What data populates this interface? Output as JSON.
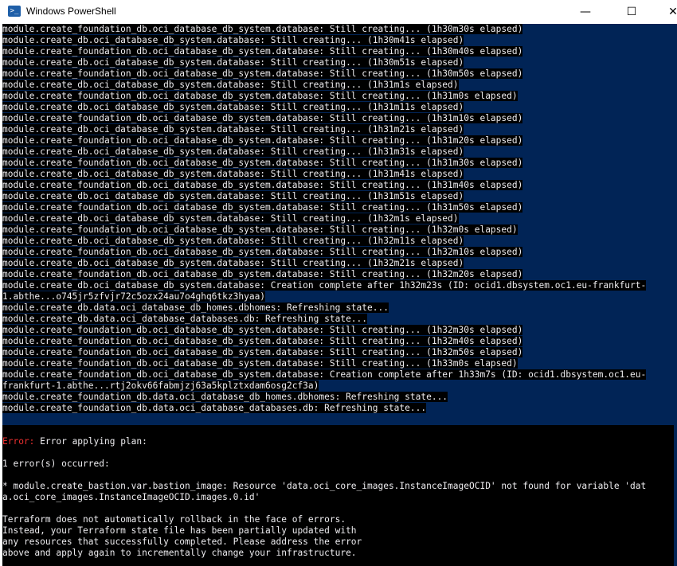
{
  "window": {
    "title": "Windows PowerShell",
    "icon": "powershell-icon",
    "minimize_glyph": "—",
    "maximize_glyph": "☐",
    "close_glyph": "✕"
  },
  "colors": {
    "console_bg": "#012456",
    "output_bg": "#000000",
    "text": "#eeedf0",
    "error": "#ee3030"
  },
  "log_lines": [
    "module.create_foundation_db.oci_database_db_system.database: Still creating... (1h30m30s elapsed)",
    "module.create_db.oci_database_db_system.database: Still creating... (1h30m41s elapsed)",
    "module.create_foundation_db.oci_database_db_system.database: Still creating... (1h30m40s elapsed)",
    "module.create_db.oci_database_db_system.database: Still creating... (1h30m51s elapsed)",
    "module.create_foundation_db.oci_database_db_system.database: Still creating... (1h30m50s elapsed)",
    "module.create_db.oci_database_db_system.database: Still creating... (1h31m1s elapsed)",
    "module.create_foundation_db.oci_database_db_system.database: Still creating... (1h31m0s elapsed)",
    "module.create_db.oci_database_db_system.database: Still creating... (1h31m11s elapsed)",
    "module.create_foundation_db.oci_database_db_system.database: Still creating... (1h31m10s elapsed)",
    "module.create_db.oci_database_db_system.database: Still creating... (1h31m21s elapsed)",
    "module.create_foundation_db.oci_database_db_system.database: Still creating... (1h31m20s elapsed)",
    "module.create_db.oci_database_db_system.database: Still creating... (1h31m31s elapsed)",
    "module.create_foundation_db.oci_database_db_system.database: Still creating... (1h31m30s elapsed)",
    "module.create_db.oci_database_db_system.database: Still creating... (1h31m41s elapsed)",
    "module.create_foundation_db.oci_database_db_system.database: Still creating... (1h31m40s elapsed)",
    "module.create_db.oci_database_db_system.database: Still creating... (1h31m51s elapsed)",
    "module.create_foundation_db.oci_database_db_system.database: Still creating... (1h31m50s elapsed)",
    "module.create_db.oci_database_db_system.database: Still creating... (1h32m1s elapsed)",
    "module.create_foundation_db.oci_database_db_system.database: Still creating... (1h32m0s elapsed)",
    "module.create_db.oci_database_db_system.database: Still creating... (1h32m11s elapsed)",
    "module.create_foundation_db.oci_database_db_system.database: Still creating... (1h32m10s elapsed)",
    "module.create_db.oci_database_db_system.database: Still creating... (1h32m21s elapsed)",
    "module.create_foundation_db.oci_database_db_system.database: Still creating... (1h32m20s elapsed)",
    "module.create_db.oci_database_db_system.database: Creation complete after 1h32m23s (ID: ocid1.dbsystem.oc1.eu-frankfurt-",
    "1.abthe...o745jr5zfvjr72c5ozx24au7o4ghq6tkz3hyaa)",
    "module.create_db.data.oci_database_db_homes.dbhomes: Refreshing state...",
    "module.create_db.data.oci_database_databases.db: Refreshing state...",
    "module.create_foundation_db.oci_database_db_system.database: Still creating... (1h32m30s elapsed)",
    "module.create_foundation_db.oci_database_db_system.database: Still creating... (1h32m40s elapsed)",
    "module.create_foundation_db.oci_database_db_system.database: Still creating... (1h32m50s elapsed)",
    "module.create_foundation_db.oci_database_db_system.database: Still creating... (1h33m0s elapsed)",
    "module.create_foundation_db.oci_database_db_system.database: Creation complete after 1h33m7s (ID: ocid1.dbsystem.oc1.eu-",
    "frankfurt-1.abthe...rtj2okv66fabmjzj63a5kplztxdam6osg2cf3a)",
    "module.create_foundation_db.data.oci_database_db_homes.dbhomes: Refreshing state...",
    "module.create_foundation_db.data.oci_database_databases.db: Refreshing state..."
  ],
  "error_block": {
    "error_label": "Error:",
    "error_message": " Error applying plan:",
    "count_line": "1 error(s) occurred:",
    "detail_line_1": "* module.create_bastion.var.bastion_image: Resource 'data.oci_core_images.InstanceImageOCID' not found for variable 'dat",
    "detail_line_2": "a.oci_core_images.InstanceImageOCID.images.0.id'",
    "note_lines": [
      "Terraform does not automatically rollback in the face of errors.",
      "Instead, your Terraform state file has been partially updated with",
      "any resources that successfully completed. Please address the error",
      "above and apply again to incrementally change your infrastructure."
    ]
  }
}
